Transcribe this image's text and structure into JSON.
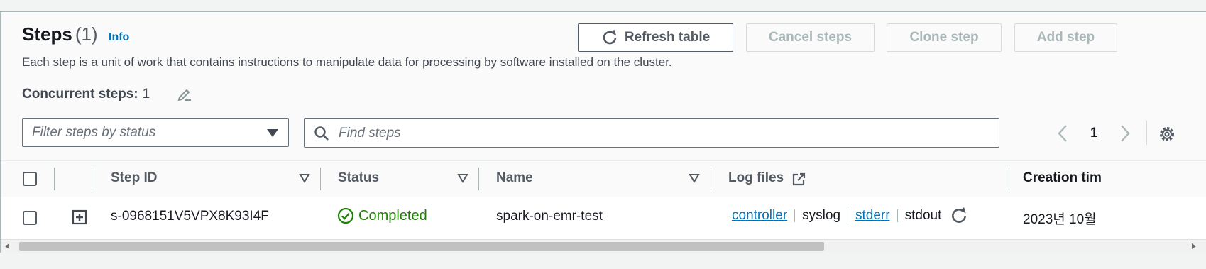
{
  "header": {
    "title": "Steps",
    "count": "(1)",
    "info": "Info",
    "description": "Each step is a unit of work that contains instructions to manipulate data for processing by software installed on the cluster.",
    "concurrent_label": "Concurrent steps:",
    "concurrent_value": "1"
  },
  "actions": {
    "refresh": "Refresh table",
    "cancel": "Cancel steps",
    "clone": "Clone step",
    "add": "Add step"
  },
  "filters": {
    "status_placeholder": "Filter steps by status",
    "search_placeholder": "Find steps"
  },
  "pagination": {
    "current_page": "1"
  },
  "table": {
    "columns": {
      "step_id": "Step ID",
      "status": "Status",
      "name": "Name",
      "log_files": "Log files",
      "creation_time": "Creation tim"
    },
    "rows": [
      {
        "step_id": "s-0968151V5VPX8K93I4F",
        "status": "Completed",
        "name": "spark-on-emr-test",
        "logs": {
          "controller": "controller",
          "syslog": "syslog",
          "stderr": "stderr",
          "stdout": "stdout"
        },
        "creation_time": "2023년 10월"
      }
    ]
  },
  "colors": {
    "link": "#0073bb",
    "success": "#1d8102",
    "disabled_text": "#aab7b8",
    "border": "#687078"
  },
  "icons": {
    "refresh": "refresh-icon",
    "edit": "pencil-icon",
    "search": "search-icon",
    "settings": "gear-icon",
    "status": "check-circle-icon",
    "external": "external-link-icon",
    "expand": "plus-square-icon"
  }
}
